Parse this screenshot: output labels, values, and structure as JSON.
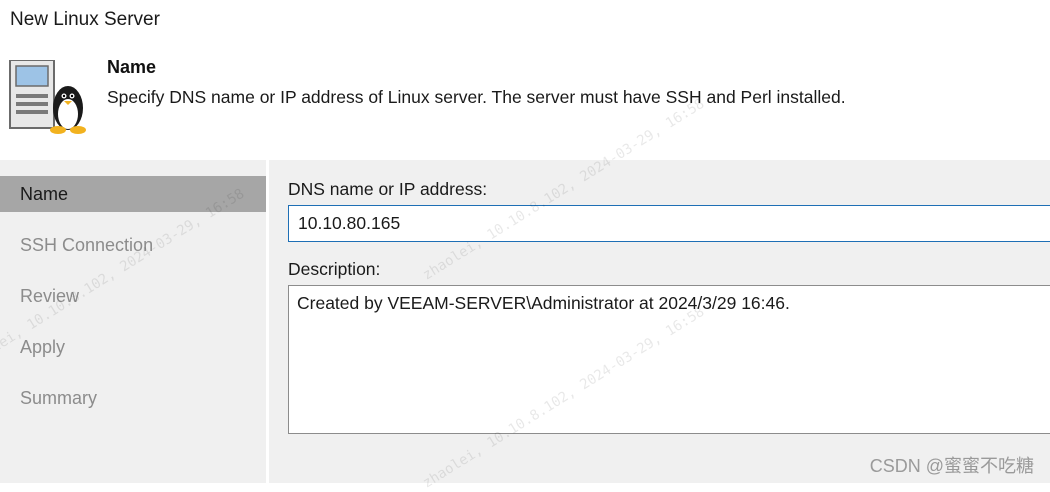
{
  "window": {
    "title": "New Linux Server"
  },
  "header": {
    "icon": "linux-server-icon",
    "step_title": "Name",
    "step_description": "Specify DNS name or IP address of Linux server. The server must have SSH and Perl installed."
  },
  "sidebar": {
    "items": [
      {
        "label": "Name",
        "active": true
      },
      {
        "label": "SSH Connection",
        "active": false
      },
      {
        "label": "Review",
        "active": false
      },
      {
        "label": "Apply",
        "active": false
      },
      {
        "label": "Summary",
        "active": false
      }
    ]
  },
  "form": {
    "dns_label": "DNS name or IP address:",
    "dns_value": "10.10.80.165",
    "description_label": "Description:",
    "description_value": "Created by VEEAM-SERVER\\Administrator at 2024/3/29 16:46."
  },
  "watermark": {
    "text": "zhaolei, 10.10.8.102, 2024-03-29, 16:58",
    "csdn": "CSDN @蜜蜜不吃糖"
  },
  "colors": {
    "active_nav_bg": "#a6a6a6",
    "panel_bg": "#f0f0f0",
    "input_focus_border": "#1e6fb5"
  }
}
